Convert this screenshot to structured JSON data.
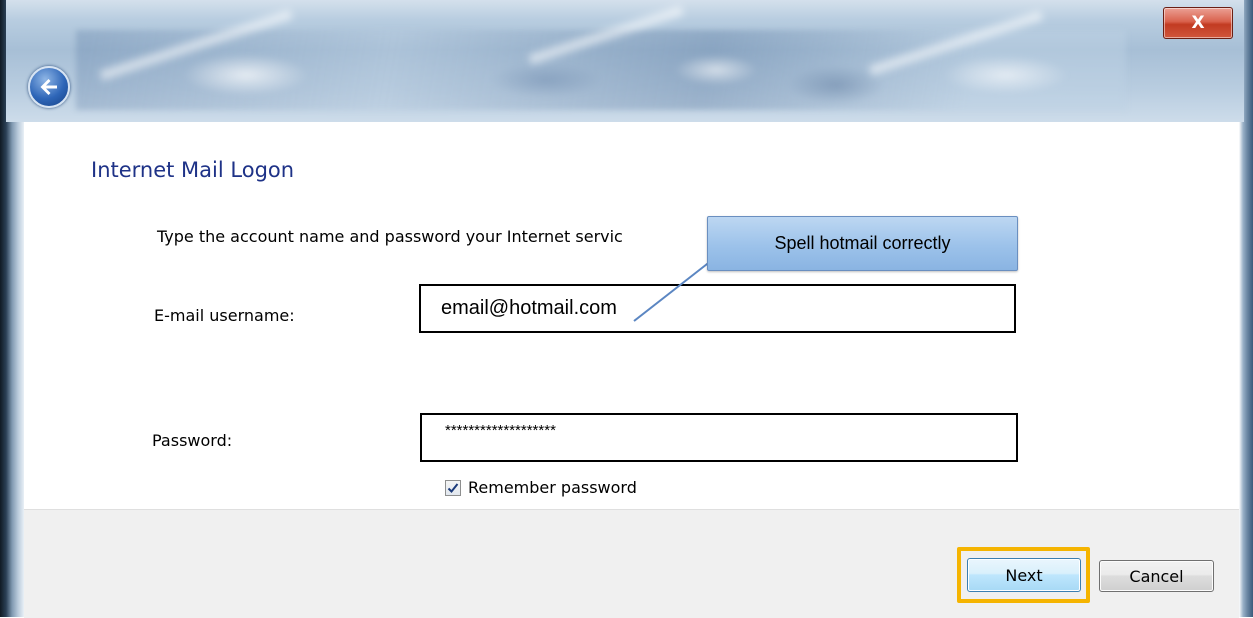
{
  "window": {
    "close_label": "X"
  },
  "dialog": {
    "title": "Internet Mail Logon",
    "instruction": "Type the account name and password your Internet servic"
  },
  "form": {
    "username_label": "E-mail username:",
    "username_value": "email@hotmail.com",
    "password_label": "Password:",
    "password_value": "*******************",
    "remember_label": "Remember password",
    "remember_checked": true
  },
  "callout": {
    "text": "Spell hotmail correctly"
  },
  "buttons": {
    "next_label": "Next",
    "cancel_label": "Cancel"
  },
  "colors": {
    "heading": "#1e3287",
    "highlight": "#f5b400",
    "callout_fill": "#9cc2ea",
    "close_button": "#c23b22"
  },
  "icons": {
    "back": "back-arrow-icon",
    "check": "checkmark-icon"
  }
}
